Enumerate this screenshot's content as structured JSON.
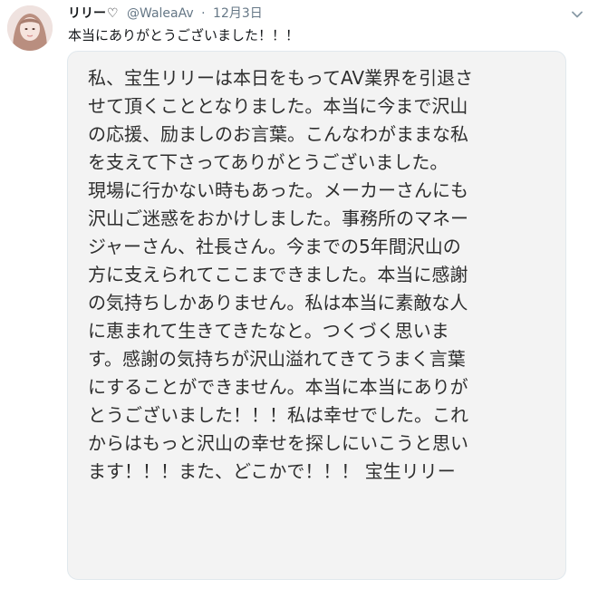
{
  "tweet": {
    "display_name": "リリー",
    "name_suffix": "♡",
    "handle": "@WaleaAv",
    "separator": "·",
    "date": "12月3日",
    "text": "本当にありがとうございました！！！"
  },
  "media": {
    "lines": [
      "私、宝生リリーは本日をもってAV業界を引退さ",
      "せて頂くこととなりました。本当に今まで沢山",
      "の応援、励ましのお言葉。こんなわがままな私",
      "を支えて下さってありがとうございました。",
      "現場に行かない時もあった。メーカーさんにも",
      "沢山ご迷惑をおかけしました。事務所のマネー",
      "ジャーさん、社長さん。今までの5年間沢山の",
      "方に支えられてここまできました。本当に感謝",
      "の気持ちしかありません。私は本当に素敵な人",
      "に恵まれて生きてきたなと。つくづく思いま",
      "す。感謝の気持ちが沢山溢れてきてうまく言葉",
      "にすることができません。本当に本当にありが",
      "とうございました！！！私は幸せでした。これ",
      "からはもっと沢山の幸せを探しにいこうと思い",
      "ます！！！また、どこかで！！！ 宝生リリー"
    ]
  },
  "icons": {
    "avatar": "avatar-photo",
    "menu": "chevron-down-icon"
  },
  "colors": {
    "text": "#14171a",
    "secondary": "#657786",
    "media_bg": "#f3f3f3",
    "border": "#e1e8ed"
  }
}
